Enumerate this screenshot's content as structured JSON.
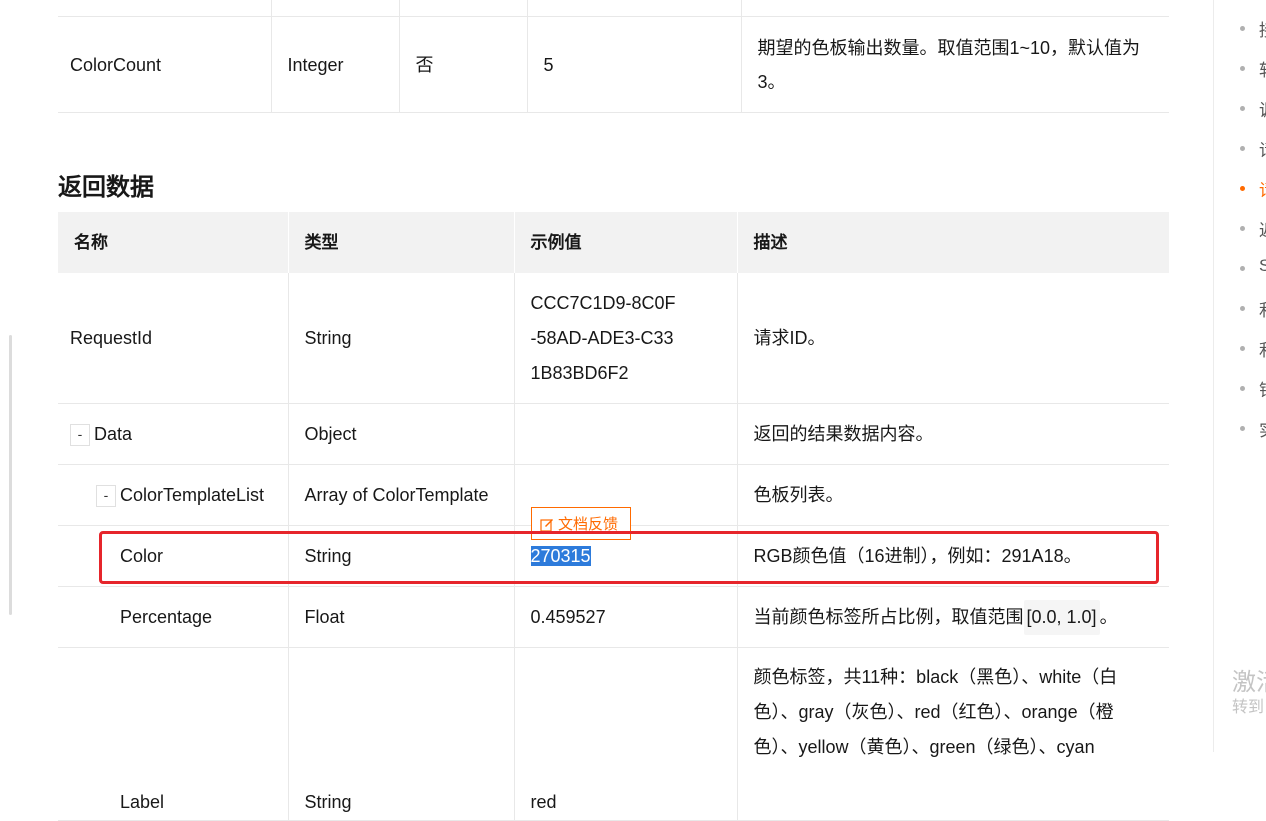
{
  "params_table": {
    "row": {
      "name": "ColorCount",
      "type": "Integer",
      "required": "否",
      "example": "5",
      "desc": "期望的色板输出数量。取值范围1~10，默认值为3。"
    }
  },
  "section_title": "返回数据",
  "response_table": {
    "headers": [
      "名称",
      "类型",
      "示例值",
      "描述"
    ],
    "rows": {
      "request_id": {
        "name": "RequestId",
        "type": "String",
        "example": "CCC7C1D9-8C0F-58AD-ADE3-C331B83BD6F2",
        "desc": "请求ID。"
      },
      "data": {
        "toggle": "-",
        "name": "Data",
        "type": "Object",
        "example": "",
        "desc": "返回的结果数据内容。"
      },
      "color_template_list": {
        "toggle": "-",
        "name": "ColorTemplateList",
        "type": "Array of ColorTemplate",
        "example": "",
        "desc": "色板列表。"
      },
      "color": {
        "name": "Color",
        "type": "String",
        "example": "270315",
        "desc": "RGB颜色值（16进制），例如：291A18。"
      },
      "percentage": {
        "name": "Percentage",
        "type": "Float",
        "example": "0.459527",
        "desc_prefix": "当前颜色标签所占比例，取值范围",
        "desc_code": "[0.0, 1.0]",
        "desc_suffix": "。"
      },
      "label": {
        "name": "Label",
        "type": "String",
        "example": "red",
        "desc": "颜色标签，共11种：black（黑色）、white（白色）、gray（灰色）、red（红色）、orange（橙色）、yellow（黄色）、green（绿色）、cyan"
      }
    }
  },
  "feedback_button": {
    "label": "文档反馈"
  },
  "toc": {
    "items": [
      {
        "text": "接"
      },
      {
        "text": "软"
      },
      {
        "text": "调"
      },
      {
        "text": "请"
      },
      {
        "text": "请"
      },
      {
        "text": "返"
      },
      {
        "text": "S"
      },
      {
        "text": "利"
      },
      {
        "text": "利"
      },
      {
        "text": "错"
      },
      {
        "text": "实"
      }
    ],
    "active_index": 4
  },
  "watermark": {
    "line1": "激活",
    "line2": "转到"
  },
  "colors": {
    "accent": "#ff6a00",
    "highlight": "#e6252b",
    "selection": "#2d7bdb"
  }
}
